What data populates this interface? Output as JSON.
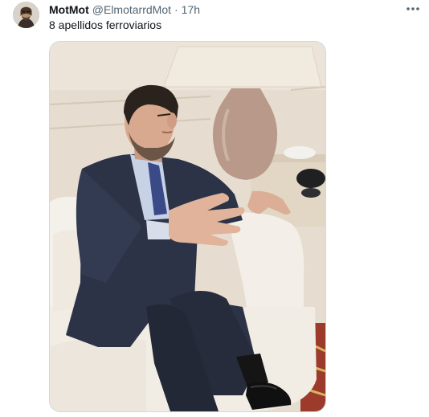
{
  "tweet": {
    "display_name": "MotMot",
    "handle": "@ElmotarrdMot",
    "separator": "·",
    "time": "17h",
    "text": "8 apellidos ferroviarios"
  },
  "icons": {
    "more": "more-horizontal-icon"
  },
  "colors": {
    "secondary_text": "#536471",
    "primary_text": "#0f1419",
    "border": "#cfd9de"
  }
}
